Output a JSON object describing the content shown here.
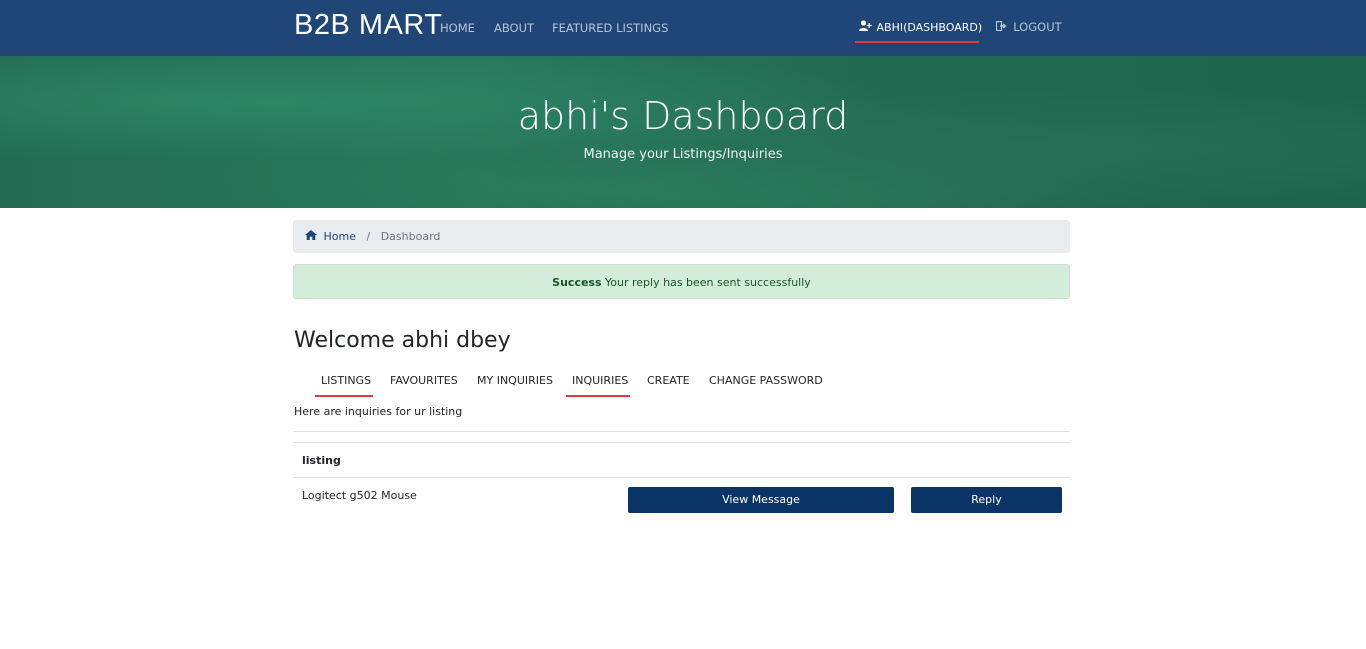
{
  "nav": {
    "brand": "B2B MART",
    "home": "HOME",
    "about": "ABOUT",
    "featured": "FEATURED LISTINGS",
    "dashboard": "ABHI(DASHBOARD)",
    "logout": "LOGOUT"
  },
  "hero": {
    "title": "abhi's Dashboard",
    "subtitle": "Manage your Listings/Inquiries"
  },
  "breadcrumb": {
    "home": "Home",
    "separator": "/",
    "current": "Dashboard"
  },
  "alert": {
    "strong": "Success",
    "message": "Your reply has been sent successfully"
  },
  "welcome": "Welcome abhi dbey",
  "tabs": [
    {
      "label": "LISTINGS"
    },
    {
      "label": "FAVOURITES"
    },
    {
      "label": "MY INQUIRIES"
    },
    {
      "label": "INQUIRIES"
    },
    {
      "label": "CREATE"
    },
    {
      "label": "CHANGE PASSWORD"
    }
  ],
  "intro": "Here are inquiries for ur listing",
  "table": {
    "header": "listing",
    "rows": [
      {
        "name": "Logitect g502 Mouse",
        "view": "View Message",
        "reply": "Reply"
      }
    ]
  },
  "colors": {
    "navbar": "#1f4677",
    "accent_underline": "#e03a3e",
    "button": "#0b3466",
    "success_bg": "#d4edda"
  }
}
